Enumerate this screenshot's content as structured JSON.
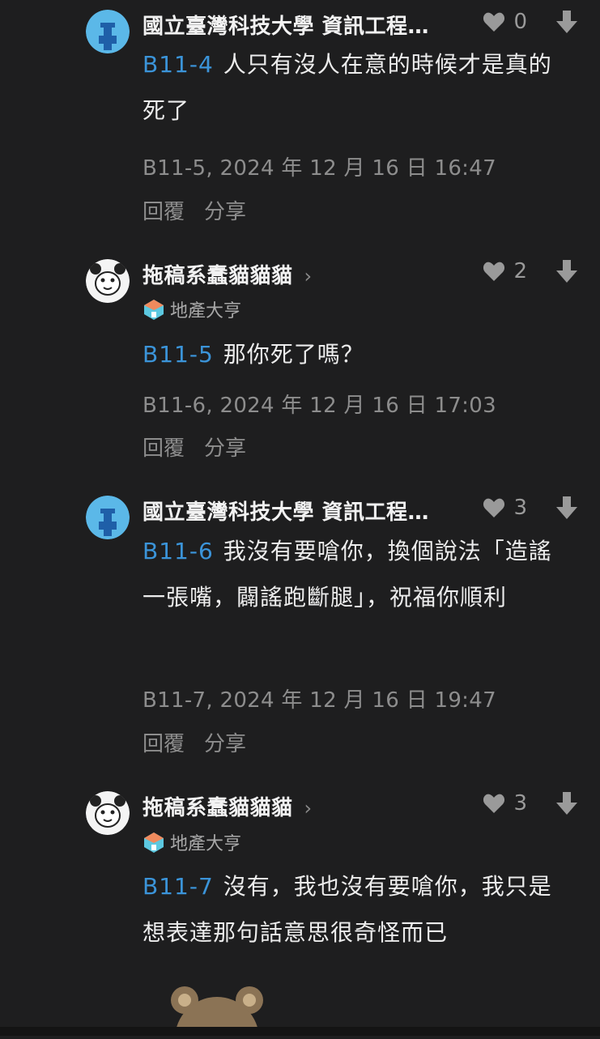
{
  "comments": [
    {
      "author": "國立臺灣科技大學 資訊工程…",
      "likes": "0",
      "floor_ref": "B11-4",
      "text": "人只有沒人在意的時候才是真的死了",
      "meta": "B11-5, 2024 年 12 月 16 日 16:47",
      "reply": "回覆",
      "share": "分享"
    },
    {
      "author": "拖稿系蠢貓貓貓",
      "likes": "2",
      "badge": "地產大亨",
      "floor_ref": "B11-5",
      "text": "那你死了嗎？",
      "meta": "B11-6, 2024 年 12 月 16 日 17:03",
      "reply": "回覆",
      "share": "分享"
    },
    {
      "author": "國立臺灣科技大學 資訊工程…",
      "likes": "3",
      "floor_ref": "B11-6",
      "text": "我沒有要嗆你，換個說法「造謠一張嘴，闢謠跑斷腿」，祝福你順利",
      "meta": "B11-7, 2024 年 12 月 16 日 19:47",
      "reply": "回覆",
      "share": "分享"
    },
    {
      "author": "拖稿系蠢貓貓貓",
      "likes": "3",
      "badge": "地產大亨",
      "floor_ref": "B11-7",
      "text": "沒有，我也沒有要嗆你，我只是想表達那句話意思很奇怪而已"
    }
  ],
  "icons": {
    "heart": "heart-icon",
    "downvote": "downvote-arrow-icon",
    "chevron": "chevron-right-icon",
    "badge": "house-badge-icon"
  },
  "colors": {
    "background": "#1e1e1f",
    "floor_ref": "#3b94d9",
    "avatar_school": "#5bb8e8"
  }
}
